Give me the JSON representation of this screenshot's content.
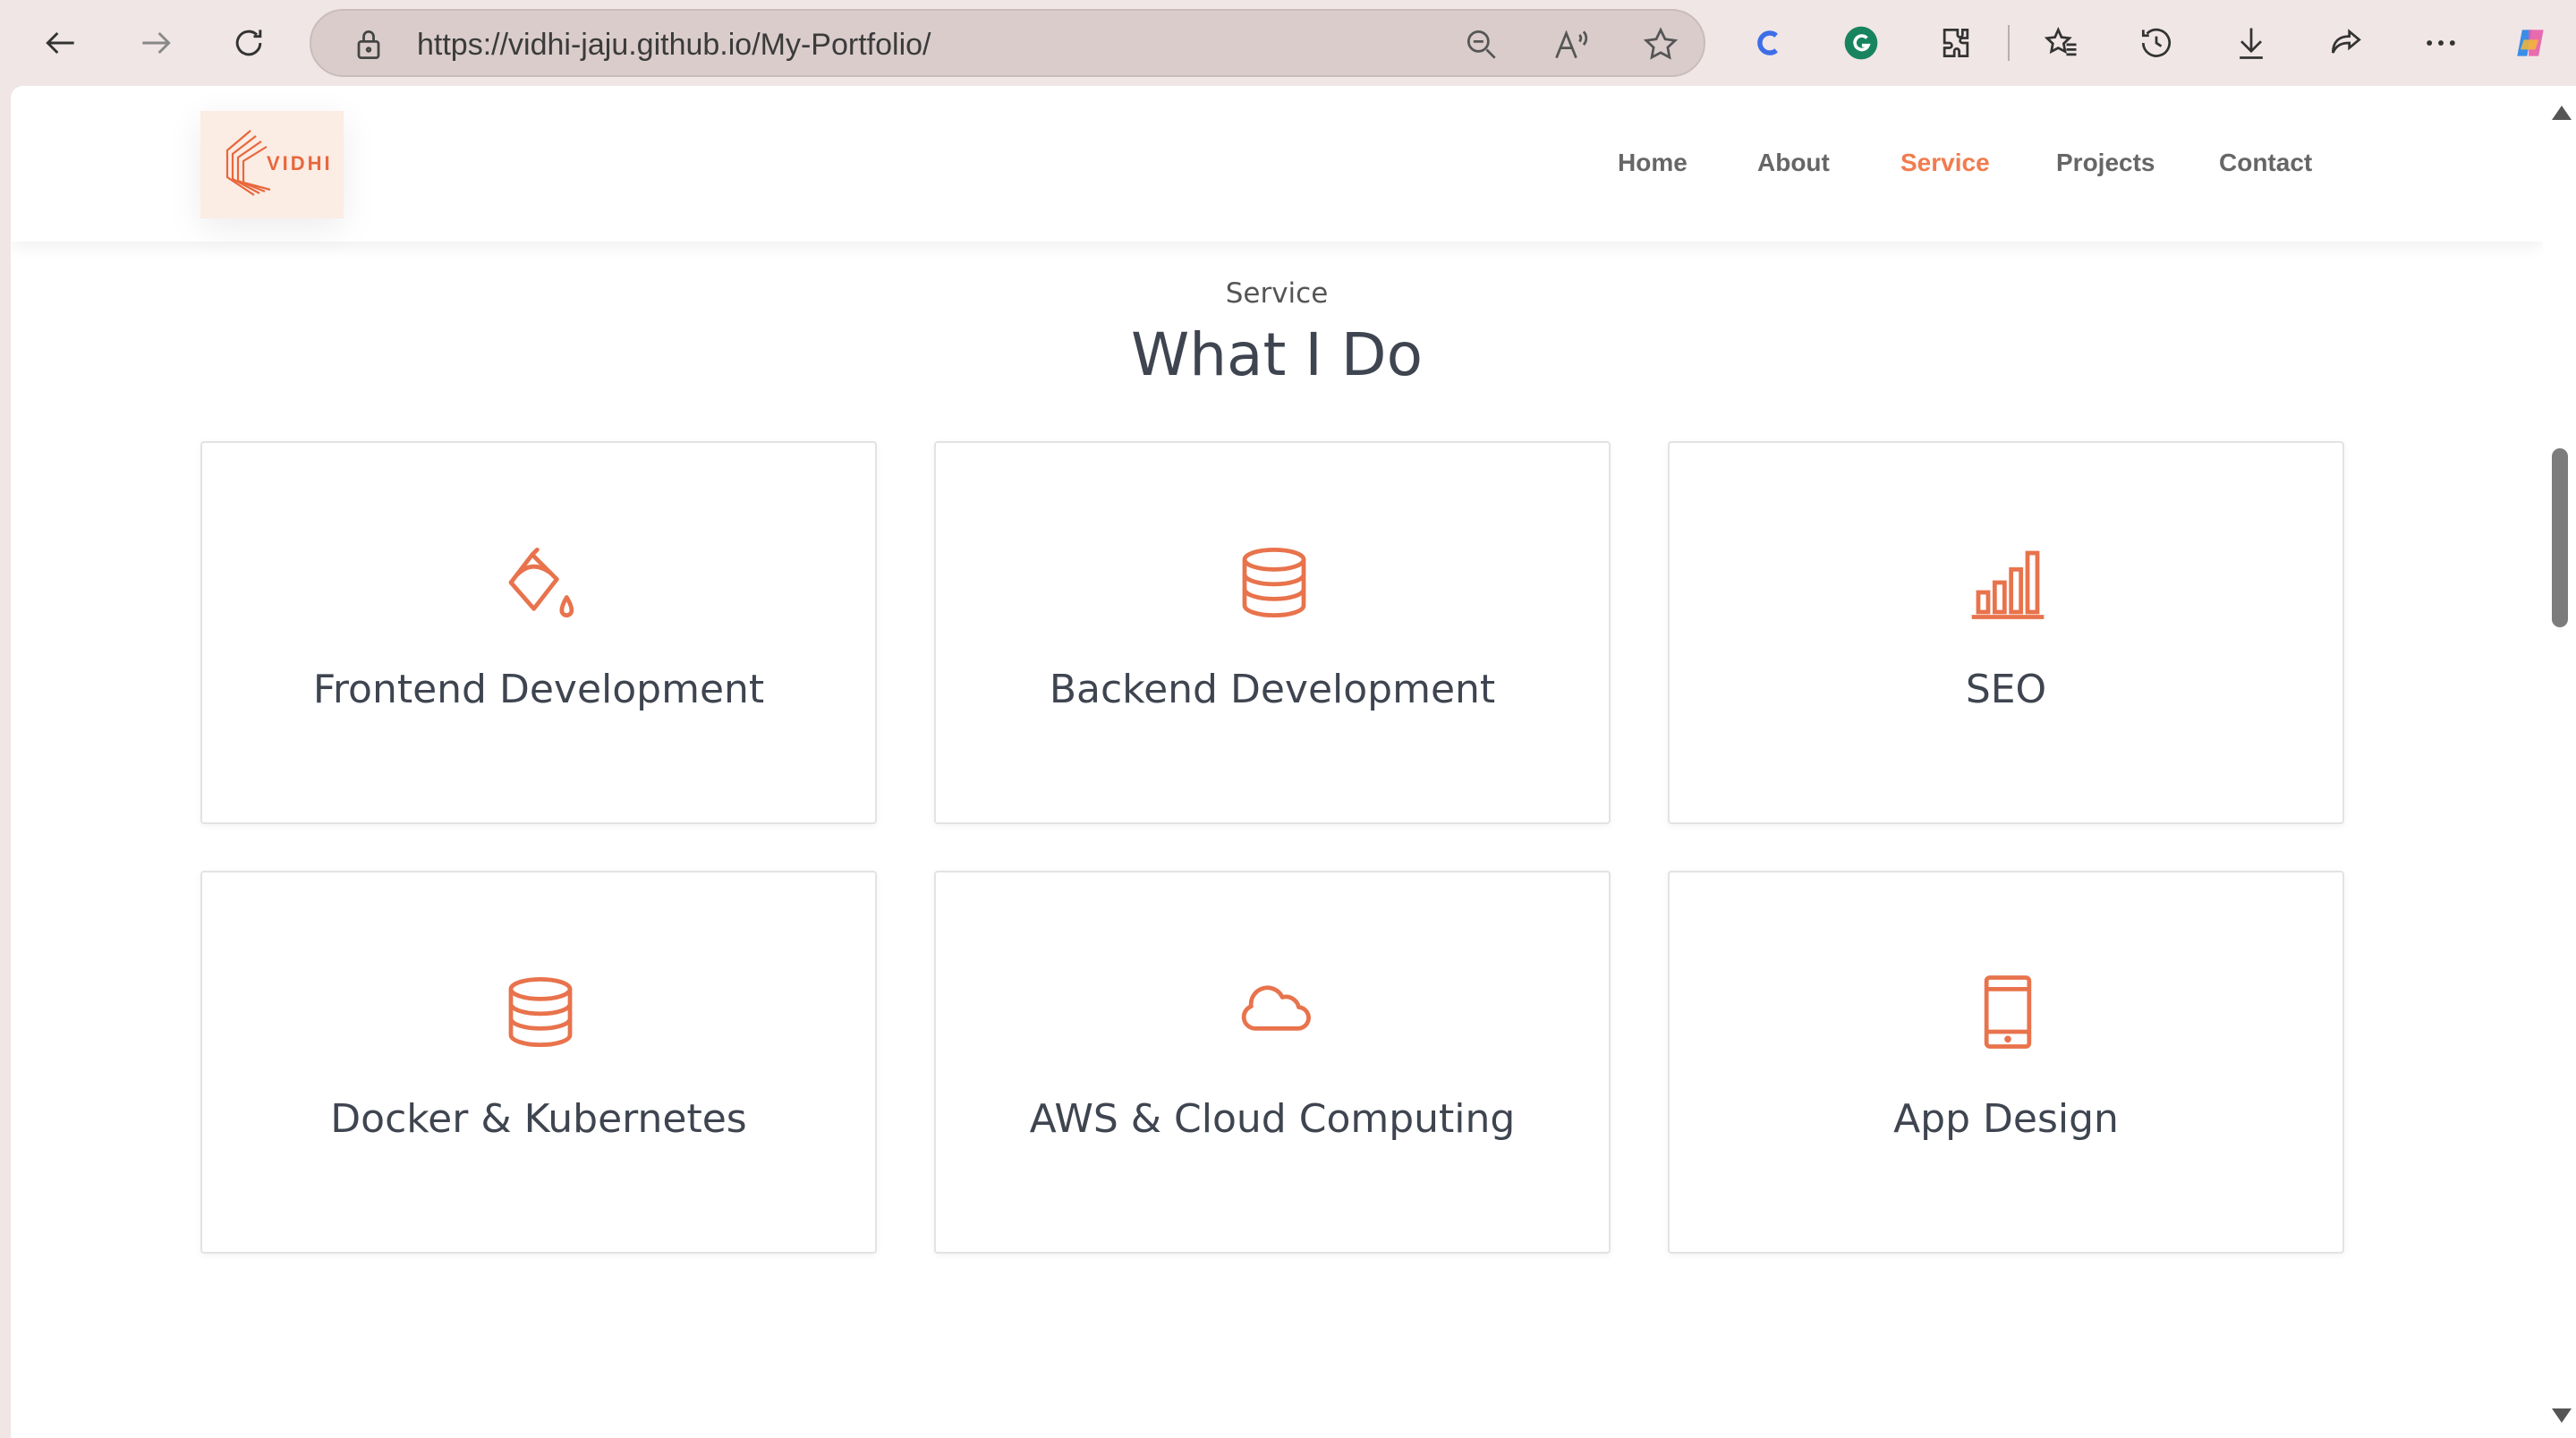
{
  "browser": {
    "url": "https://vidhi-jaju.github.io/My-Portfolio/",
    "icons": [
      "back-icon",
      "forward-icon",
      "refresh-icon",
      "lock-icon",
      "zoom-icon",
      "read-aloud-icon",
      "favorite-star-icon",
      "extension-c-icon",
      "grammarly-icon",
      "extensions-icon",
      "favorites-icon",
      "history-icon",
      "download-icon",
      "share-icon",
      "more-icon",
      "copilot-icon"
    ]
  },
  "header": {
    "logo_text": "VIDHI",
    "nav": [
      "Home",
      "About",
      "Service",
      "Projects",
      "Contact"
    ],
    "active": "Service"
  },
  "section": {
    "subtitle": "Service",
    "title": "What I Do"
  },
  "services": [
    {
      "label": "Frontend Development",
      "icon": "paint-bucket-icon"
    },
    {
      "label": "Backend Development",
      "icon": "database-icon"
    },
    {
      "label": "SEO",
      "icon": "bar-chart-icon"
    },
    {
      "label": "Docker & Kubernetes",
      "icon": "database-icon"
    },
    {
      "label": "AWS & Cloud Computing",
      "icon": "cloud-icon"
    },
    {
      "label": "App Design",
      "icon": "tablet-icon"
    }
  ],
  "colors": {
    "accent": "#f07c4f",
    "icon": "#e8734c",
    "text": "#3f4550"
  }
}
